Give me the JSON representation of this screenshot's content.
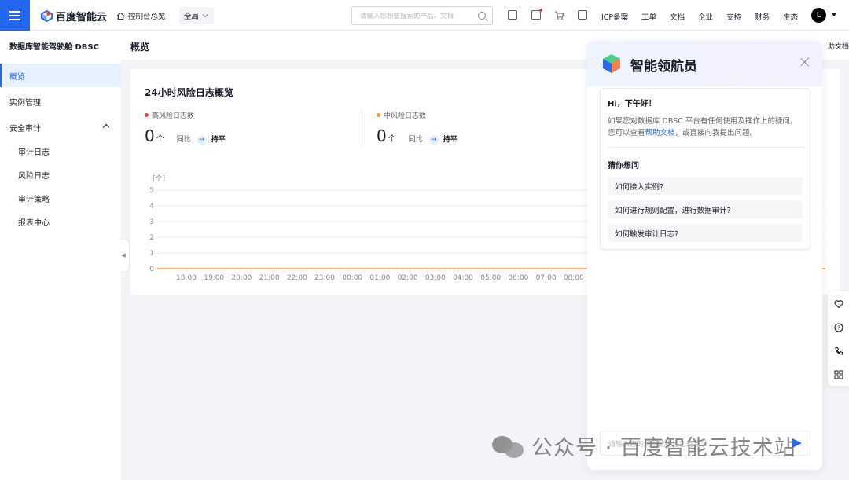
{
  "topbar": {
    "brand": "百度智能云",
    "console_home": "控制台总览",
    "scope": "全局",
    "search_placeholder": "请输入您想要搜索的产品、文档",
    "links": [
      "ICP备案",
      "工单",
      "文档",
      "企业",
      "支持",
      "财务",
      "生态"
    ],
    "avatar_letter": "L"
  },
  "sidebar": {
    "title": "数据库智能驾驶舱 DBSC",
    "items": [
      {
        "label": "概览",
        "active": true
      },
      {
        "label": "实例管理"
      },
      {
        "label": "安全审计",
        "expanded": true
      }
    ],
    "sub_items": [
      "审计日志",
      "风险日志",
      "审计策略",
      "报表中心"
    ]
  },
  "page": {
    "title": "概览",
    "help_doc": "助文档"
  },
  "overview_card": {
    "title": "24小时风险日志概览",
    "metrics": [
      {
        "label": "高风险日志数",
        "value": "0",
        "unit": "个",
        "yoy_label": "同比",
        "trend": "持平",
        "color": "#f33e3e"
      },
      {
        "label": "中风险日志数",
        "value": "0",
        "unit": "个",
        "yoy_label": "同比",
        "trend": "持平",
        "color": "#ff9326"
      }
    ]
  },
  "chart_data": {
    "type": "line",
    "ylabel": "[个]",
    "ylim": [
      0,
      5
    ],
    "yticks": [
      "0",
      "1",
      "2",
      "3",
      "4",
      "5"
    ],
    "categories": [
      "18:00",
      "19:00",
      "20:00",
      "21:00",
      "22:00",
      "23:00",
      "00:00",
      "01:00",
      "02:00",
      "03:00",
      "04:00",
      "05:00",
      "06:00",
      "07:00",
      "08:00"
    ],
    "series": [
      {
        "values": [
          0,
          0,
          0,
          0,
          0,
          0,
          0,
          0,
          0,
          0,
          0,
          0,
          0,
          0,
          0
        ],
        "color": "#ff9326"
      }
    ],
    "grid": true
  },
  "assistant": {
    "title": "智能领航员",
    "greeting": "Hi，下午好！",
    "intro_pre": "如果您对数据库 DBSC 平台有任何使用及操作上的疑问，您可以查看",
    "intro_link": "帮助文档",
    "intro_post": "，或直接向我提出问题。",
    "guess_title": "猜你想问",
    "questions": [
      "如何接入实例?",
      "如何进行规则配置，进行数据审计?",
      "如何触发审计日志?"
    ],
    "input_placeholder": "请输入您的问题或描述您的需求"
  },
  "watermark": "公众号 · 百度智能云技术站"
}
